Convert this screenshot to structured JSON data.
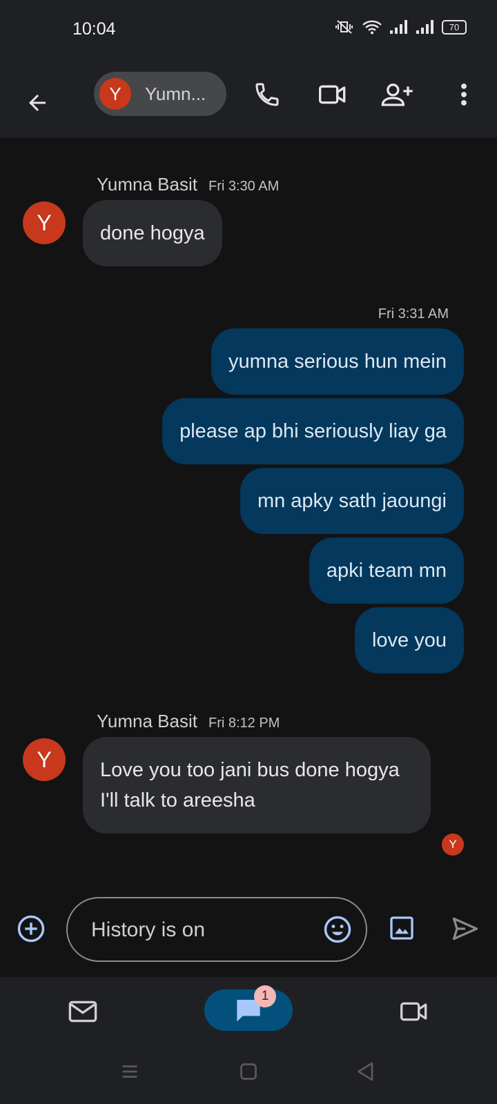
{
  "status_bar": {
    "time": "10:04",
    "battery": "70"
  },
  "header": {
    "contact_initial": "Y",
    "contact_name": "Yumn..."
  },
  "messages": [
    {
      "direction": "incoming",
      "sender": "Yumna Basit",
      "time": "Fri 3:30 AM",
      "avatar": "Y",
      "text": "done hogya"
    },
    {
      "direction": "outgoing",
      "time": "Fri 3:31 AM",
      "texts": [
        "yumna serious hun mein",
        "please ap bhi seriously liay ga",
        "mn apky sath jaoungi",
        "apki team mn",
        "love you"
      ]
    },
    {
      "direction": "incoming",
      "sender": "Yumna Basit",
      "time": "Fri 8:12 PM",
      "avatar": "Y",
      "text": "Love you too jani bus done hogya I'll talk to areesha"
    }
  ],
  "read_receipt": "Y",
  "compose": {
    "placeholder": "History is on"
  },
  "bottom_nav": {
    "chat_badge": "1"
  },
  "colors": {
    "avatar": "#c8381c",
    "outgoing_bubble": "#04385c",
    "incoming_bubble": "#2b2c2f",
    "accent": "#a8c7fa"
  }
}
